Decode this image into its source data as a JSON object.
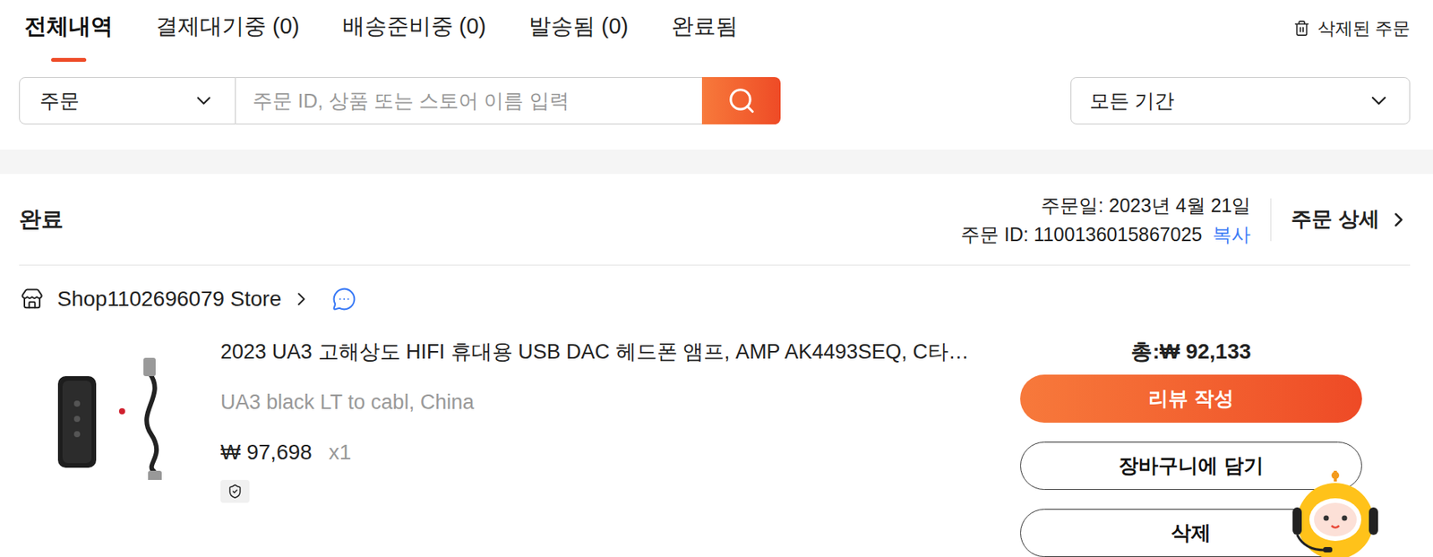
{
  "tabs": [
    {
      "label": "전체내역",
      "selected": true
    },
    {
      "label": "결제대기중 (0)",
      "selected": false
    },
    {
      "label": "배송준비중 (0)",
      "selected": false
    },
    {
      "label": "발송됨 (0)",
      "selected": false
    },
    {
      "label": "완료됨",
      "selected": false
    }
  ],
  "deleted_orders": "삭제된 주문",
  "search": {
    "category": "주문",
    "placeholder": "주문 ID, 상품 또는 스토어 이름 입력",
    "period": "모든 기간"
  },
  "order": {
    "status": "완료",
    "date": "주문일: 2023년 4월 21일",
    "id": "주문 ID: 1100136015867025",
    "copy": "복사",
    "detail": "주문 상세",
    "store": "Shop1102696079 Store",
    "item": {
      "title": "2023 UA3 고해상도 HIFI 휴대용 USB DAC 헤드폰 앰프, AMP AK4493SEQ, C타…",
      "variant": "UA3 black LT to cabl, China",
      "price": "₩ 97,698",
      "quantity": "x1"
    },
    "total": "총:₩ 92,133",
    "buttons": [
      "리뷰 작성",
      "장바구니에 담기",
      "삭제"
    ]
  }
}
